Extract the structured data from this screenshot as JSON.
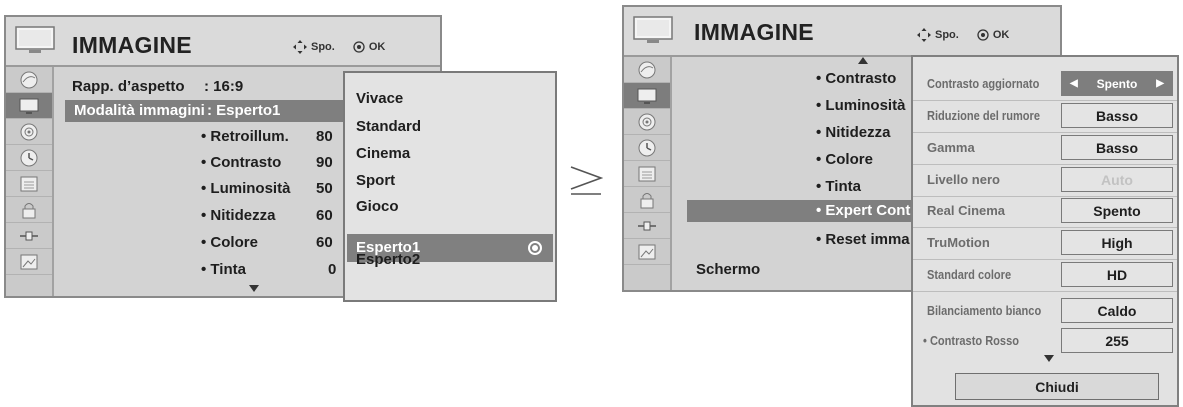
{
  "left_panel": {
    "title": "IMMAGINE",
    "hint_move": "Spo.",
    "hint_ok": "OK",
    "aspect_label": "Rapp. d’aspetto",
    "aspect_value": ": 16:9",
    "mode_label": "Modalità immagini",
    "mode_value": ":  Esperto1",
    "items": [
      {
        "label": "• Retroillum.",
        "value": "80"
      },
      {
        "label": "• Contrasto",
        "value": "90"
      },
      {
        "label": "• Luminosità",
        "value": "50"
      },
      {
        "label": "• Nitidezza",
        "value": "60"
      },
      {
        "label": "• Colore",
        "value": "60"
      },
      {
        "label": "• Tinta",
        "value": "0"
      }
    ],
    "submenu": {
      "options": [
        "Vivace",
        "Standard",
        "Cinema",
        "Sport",
        "Gioco",
        "Esperto1",
        "Esperto2"
      ],
      "selected": "Esperto1"
    }
  },
  "arrow_glyph": "≥",
  "right_panel": {
    "title": "IMMAGINE",
    "hint_move": "Spo.",
    "hint_ok": "OK",
    "items": [
      "• Contrasto",
      "• Luminosità",
      "• Nitidezza",
      "• Colore",
      "• Tinta",
      "• Expert Cont",
      "• Reset imma"
    ],
    "bottom_item": "Schermo",
    "selected_item": "• Expert Cont"
  },
  "expert_menu": {
    "rows": [
      {
        "label": "Contrasto aggiornato",
        "value": "Spento",
        "state": "active"
      },
      {
        "label": "Riduzione del rumore",
        "value": "Basso",
        "state": "normal"
      },
      {
        "label": "Gamma",
        "value": "Basso",
        "state": "normal"
      },
      {
        "label": "Livello nero",
        "value": "Auto",
        "state": "disabled"
      },
      {
        "label": "Real Cinema",
        "value": "Spento",
        "state": "normal"
      },
      {
        "label": "TruMotion",
        "value": "High",
        "state": "normal"
      },
      {
        "label": "Standard colore",
        "value": "HD",
        "state": "normal"
      },
      {
        "label": "Bilanciamento bianco",
        "value": "Caldo",
        "state": "normal"
      },
      {
        "label": "• Contrasto Rosso",
        "value": "255",
        "state": "normal"
      }
    ],
    "close_label": "Chiudi"
  },
  "colors": {
    "panel_bg": "#d3d3d3",
    "highlight": "#7f7f7f",
    "submenu_bg": "#e3e3e3",
    "disabled_text": "#c2c2c2"
  }
}
